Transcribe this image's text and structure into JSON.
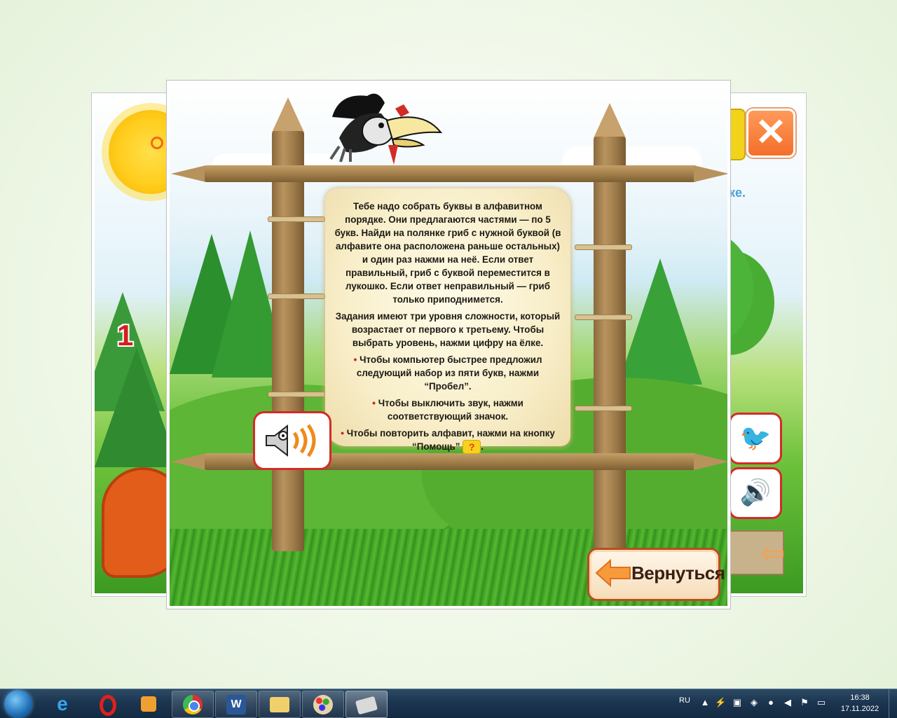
{
  "game": {
    "background_level_number": "1",
    "background_hint_fragment": "ке.",
    "instructions": {
      "paragraph1": "Тебе надо собрать буквы в алфавитном порядке. Они предлагаются частями — по 5 букв. Найди на полянке гриб с нужной буквой (в алфавите она расположена раньше остальных) и один раз нажми на неё. Если ответ правильный, гриб с буквой переместится в лукошко. Если ответ неправильный — гриб только приподнимется.",
      "paragraph2": "Задания имеют три уровня сложности, который возрастает от первого к третьему. Чтобы выбрать уровень, нажми цифру на ёлке.",
      "bullet1": "Чтобы компьютер быстрее предложил следующий набор из пяти букв, нажми “Пробел”.",
      "bullet2": "Чтобы выключить звук, нажми соответствующий значок.",
      "bullet3": "Чтобы повторить алфавит, нажми на кнопку “Помощь”",
      "bullet3_end": ".",
      "bullet_marker": "•"
    },
    "back_button_label": "Вернуться",
    "colors": {
      "accent_red": "#d22c26",
      "back_button_border": "#b84d22",
      "parchment": "#f8eec9"
    }
  },
  "taskbar": {
    "pinned": [
      "internet-explorer",
      "opera",
      "media-player",
      "chrome",
      "word",
      "file-explorer",
      "paint",
      "game-app"
    ],
    "language": "RU",
    "time": "16:38",
    "date": "17.11.2022"
  }
}
